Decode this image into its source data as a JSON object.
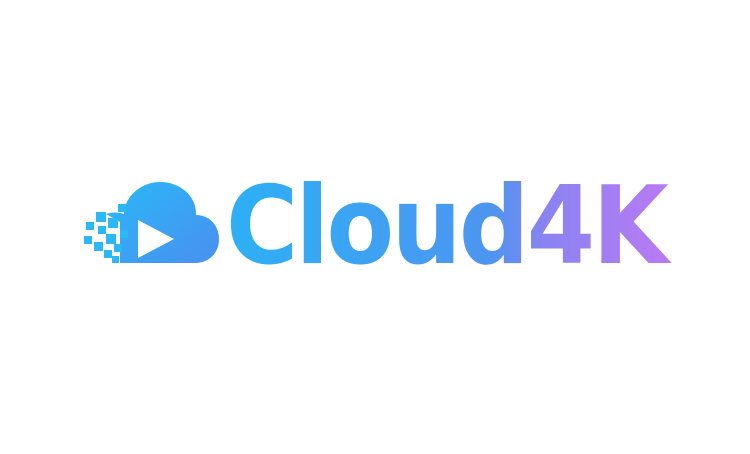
{
  "logo": {
    "wordmark": {
      "primary": "Cloud",
      "secondary": "4K"
    },
    "icon": "cloud-play-icon",
    "colors": {
      "cloud_gradient_start": "#29b6f6",
      "cloud_gradient_end": "#4a8ff0",
      "wordmark_gradient_start": "#2db0f5",
      "wordmark_gradient_mid": "#5a8df0",
      "wordmark_gradient_end": "#b57af3",
      "play_triangle": "#ffffff",
      "background": "#ffffff"
    }
  }
}
